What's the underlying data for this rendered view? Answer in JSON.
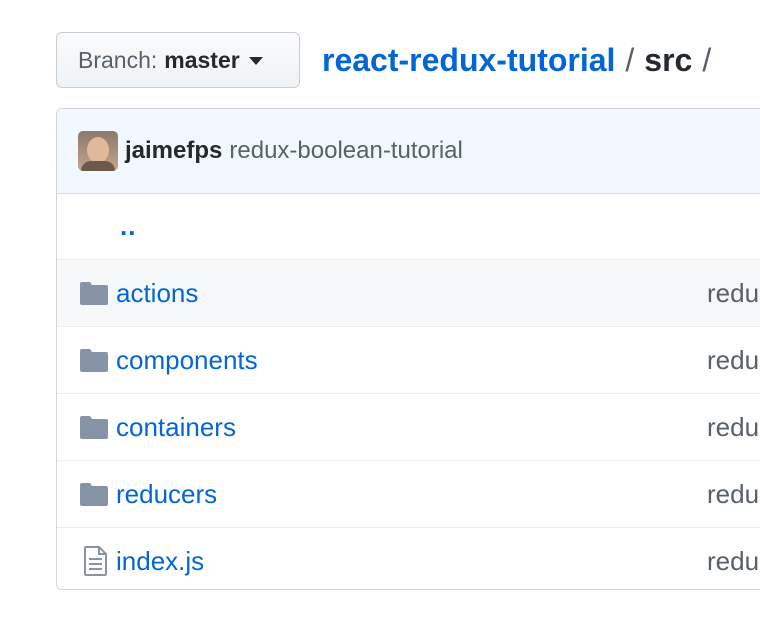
{
  "branch": {
    "label": "Branch:",
    "name": "master"
  },
  "breadcrumb": {
    "repo": "react-redux-tutorial",
    "separator": "/",
    "dir": "src",
    "trailing": "/"
  },
  "commit": {
    "author": "jaimefps",
    "message": "redux-boolean-tutorial"
  },
  "parent_dir": "..",
  "files": [
    {
      "name": "actions",
      "type": "folder",
      "message": "redu"
    },
    {
      "name": "components",
      "type": "folder",
      "message": "redu"
    },
    {
      "name": "containers",
      "type": "folder",
      "message": "redu"
    },
    {
      "name": "reducers",
      "type": "folder",
      "message": "redu"
    },
    {
      "name": "index.js",
      "type": "file",
      "message": "redu"
    }
  ],
  "colors": {
    "link": "#0366d6",
    "icon": "#8794a8",
    "header_bg": "#f1f8ff"
  }
}
